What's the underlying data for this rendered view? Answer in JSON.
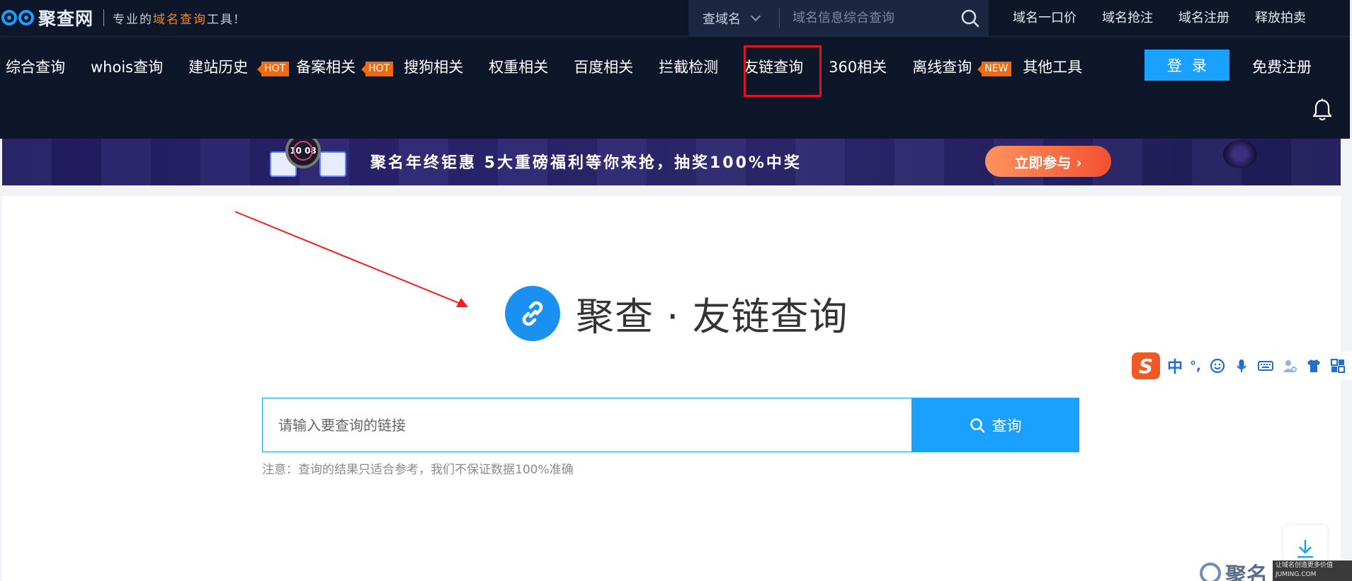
{
  "header": {
    "logo_text": "聚查网",
    "slogan_prefix": "专业的",
    "slogan_highlight": "域名查询",
    "slogan_suffix": "工具!",
    "search_scope": "查域名",
    "search_placeholder": "域名信息综合查询",
    "top_links": [
      "域名一口价",
      "域名抢注",
      "域名注册",
      "释放拍卖"
    ],
    "nav": [
      {
        "label": "综合查询"
      },
      {
        "label": "whois查询"
      },
      {
        "label": "建站历史",
        "badge": "HOT"
      },
      {
        "label": "备案相关",
        "badge": "HOT"
      },
      {
        "label": "搜狗相关"
      },
      {
        "label": "权重相关"
      },
      {
        "label": "百度相关"
      },
      {
        "label": "拦截检测"
      },
      {
        "label": "友链查询",
        "active": true
      },
      {
        "label": "360相关"
      },
      {
        "label": "离线查询",
        "badge": "NEW"
      },
      {
        "label": "其他工具"
      }
    ],
    "login_label": "登录",
    "register_label": "免费注册"
  },
  "banner": {
    "watch_text": "10 08",
    "text": "聚名年终钜惠 5大重磅福利等你来抢，抽奖100%中奖",
    "cta": "立即参与 ›"
  },
  "main": {
    "title": "聚查 · 友链查询",
    "input_placeholder": "请输入要查询的链接",
    "query_button": "查询",
    "notice": "注意：查询的结果只适合参考，我们不保证数据100%准确"
  },
  "ime": {
    "logo": "S",
    "lang": "中",
    "punct": "°,"
  },
  "footer_brand": {
    "name": "聚名",
    "tagline": "让域名创造更多价值",
    "site": "JUMING.COM"
  },
  "colors": {
    "header_bg": "#0e1729",
    "accent": "#1aa0ff",
    "badge": "#f06a14",
    "highlight_box": "#e0141e"
  }
}
